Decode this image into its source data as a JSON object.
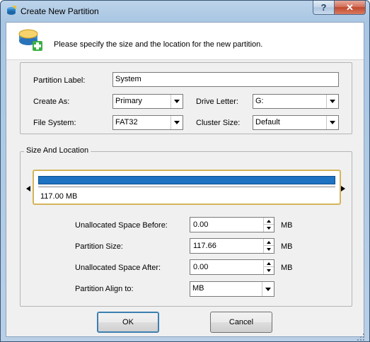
{
  "window": {
    "title": "Create New Partition",
    "help_glyph": "?",
    "close_glyph": "✕"
  },
  "header": {
    "instruction": "Please specify the size and the location for the new partition."
  },
  "form": {
    "partition_label": {
      "label": "Partition Label:",
      "value": "System"
    },
    "create_as": {
      "label": "Create As:",
      "value": "Primary"
    },
    "drive_letter": {
      "label": "Drive Letter:",
      "value": "G:"
    },
    "file_system": {
      "label": "File System:",
      "value": "FAT32"
    },
    "cluster_size": {
      "label": "Cluster Size:",
      "value": "Default"
    }
  },
  "size_location": {
    "title": "Size And Location",
    "disk_map": {
      "size_text": "117.00 MB",
      "bar_color": "#1e73c2",
      "border_color": "#d4b45a"
    },
    "unallocated_before": {
      "label": "Unallocated Space Before:",
      "value": "0.00",
      "unit": "MB"
    },
    "partition_size": {
      "label": "Partition Size:",
      "value": "117.66",
      "unit": "MB"
    },
    "unallocated_after": {
      "label": "Unallocated Space After:",
      "value": "0.00",
      "unit": "MB"
    },
    "align_to": {
      "label": "Partition Align to:",
      "value": "MB"
    }
  },
  "buttons": {
    "ok": "OK",
    "cancel": "Cancel"
  },
  "icons": {
    "app": "partition-wizard-icon",
    "header": "new-partition-icon",
    "spin_up": "arrow-up-icon",
    "spin_down": "arrow-down-icon",
    "dropdown": "chevron-down-icon"
  }
}
